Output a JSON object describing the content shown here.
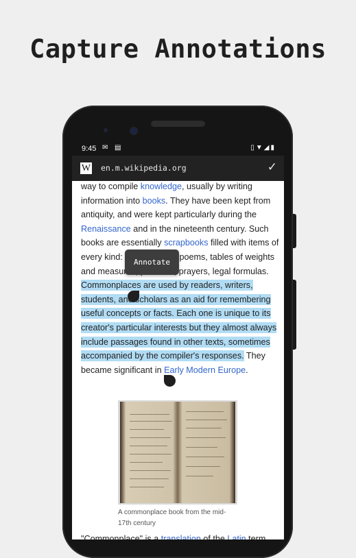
{
  "headline": "Capture Annotations",
  "status_bar": {
    "time": "9:45",
    "notification_icons": [
      "gmail-icon",
      "book-icon"
    ],
    "system_icons": [
      "vibrate-icon",
      "wifi-icon",
      "signal-icon",
      "battery-icon"
    ]
  },
  "app_bar": {
    "logo": "W",
    "url": "en.m.wikipedia.org",
    "confirm_icon": "check-icon"
  },
  "article": {
    "p1": "way to compile ",
    "link_knowledge": "knowledge",
    "p2": ", usually by writing information into ",
    "link_books": "books",
    "p3": ". They have been kept from antiquity, and were kept particularly during the ",
    "link_renaissance": "Renaissance",
    "p4": " and in the nineteenth century. Such books are essentially ",
    "link_scrapbooks": "scrapbooks",
    "p5": " filled with items of every kind: notes, letters, poems, tables of weights and measures, proverbs, prayers, legal formulas. ",
    "selected": "Commonplaces are used by readers, writers, students, and scholars as an aid for remembering useful concepts or facts. Each one is unique to its creator's particular interests but they almost always include passages found in other texts, sometimes accompanied by the compiler's responses.",
    "p6": " They became significant in ",
    "link_early_modern": "Early Modern Europe",
    "p7": "."
  },
  "selection_popup": {
    "label": "Annotate"
  },
  "figure": {
    "caption": "A commonplace book from the mid-17th century"
  },
  "tail": {
    "t1": "\"Commonplace\" is a ",
    "link_translation": "translation",
    "t2": " of the ",
    "link_latin": "Latin",
    "t3": " term"
  },
  "colors": {
    "highlight": "#b1dcf4",
    "link": "#3366cc",
    "app_bar": "#222222"
  }
}
